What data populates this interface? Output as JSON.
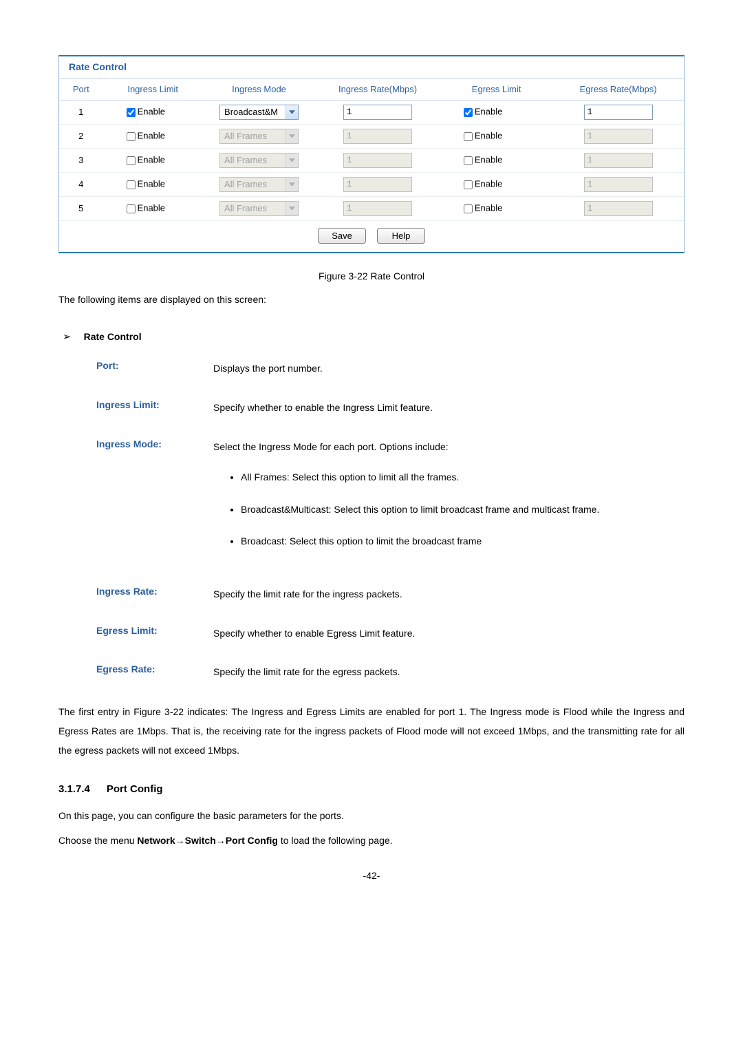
{
  "panel": {
    "title": "Rate Control",
    "headers": {
      "port": "Port",
      "ingress_limit": "Ingress Limit",
      "ingress_mode": "Ingress Mode",
      "ingress_rate": "Ingress Rate(Mbps)",
      "egress_limit": "Egress Limit",
      "egress_rate": "Egress Rate(Mbps)"
    },
    "enable_label": "Enable",
    "rows": [
      {
        "port": "1",
        "ingress_enabled": true,
        "mode": "Broadcast&M",
        "mode_disabled": false,
        "irate": "1",
        "irate_disabled": false,
        "egress_enabled": true,
        "erate": "1",
        "erate_disabled": false
      },
      {
        "port": "2",
        "ingress_enabled": false,
        "mode": "All Frames",
        "mode_disabled": true,
        "irate": "1",
        "irate_disabled": true,
        "egress_enabled": false,
        "erate": "1",
        "erate_disabled": true
      },
      {
        "port": "3",
        "ingress_enabled": false,
        "mode": "All Frames",
        "mode_disabled": true,
        "irate": "1",
        "irate_disabled": true,
        "egress_enabled": false,
        "erate": "1",
        "erate_disabled": true
      },
      {
        "port": "4",
        "ingress_enabled": false,
        "mode": "All Frames",
        "mode_disabled": true,
        "irate": "1",
        "irate_disabled": true,
        "egress_enabled": false,
        "erate": "1",
        "erate_disabled": true
      },
      {
        "port": "5",
        "ingress_enabled": false,
        "mode": "All Frames",
        "mode_disabled": true,
        "irate": "1",
        "irate_disabled": true,
        "egress_enabled": false,
        "erate": "1",
        "erate_disabled": true
      }
    ],
    "buttons": {
      "save": "Save",
      "help": "Help"
    }
  },
  "caption": "Figure 3-22 Rate Control",
  "intro": "The following items are displayed on this screen:",
  "section_label": "Rate Control",
  "defs": {
    "port": {
      "term": "Port:",
      "desc": "Displays the port number."
    },
    "ilimit": {
      "term": "Ingress Limit:",
      "desc": "Specify whether to enable the Ingress Limit feature."
    },
    "imode": {
      "term": "Ingress Mode:",
      "desc": "Select the Ingress Mode for each port. Options include:",
      "bullets": [
        "All Frames: Select this option to limit all the frames.",
        "Broadcast&Multicast: Select this option to limit broadcast frame and multicast frame.",
        "Broadcast: Select this option to limit the broadcast frame"
      ]
    },
    "irate": {
      "term": "Ingress Rate:",
      "desc": "Specify the limit rate for the ingress packets."
    },
    "elimit": {
      "term": "Egress Limit:",
      "desc": "Specify whether to enable Egress Limit feature."
    },
    "erate": {
      "term": "Egress Rate:",
      "desc": "Specify the limit rate for the egress packets."
    }
  },
  "summary_para": "The first entry in Figure 3-22 indicates: The Ingress and Egress Limits are enabled for port 1. The Ingress mode is Flood while the Ingress and Egress Rates are 1Mbps. That is, the receiving rate for the ingress packets of Flood mode will not exceed 1Mbps, and the transmitting rate for all the egress packets will not exceed 1Mbps.",
  "heading": {
    "num": "3.1.7.4",
    "title": "Port Config"
  },
  "pc_intro": "On this page, you can configure the basic parameters for the ports.",
  "nav_prefix": "Choose the menu ",
  "nav_path": "Network→Switch→Port Config",
  "nav_suffix": " to load the following page.",
  "page_num": "-42-"
}
